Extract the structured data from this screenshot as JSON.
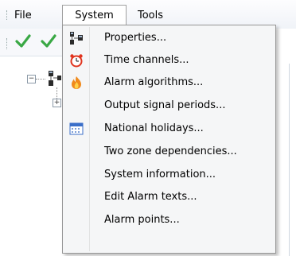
{
  "menubar": {
    "items": [
      {
        "label": "File"
      },
      {
        "label": "System"
      },
      {
        "label": "Tools"
      }
    ]
  },
  "toolbar": {
    "icons": [
      "green-checkmark-icon",
      "green-checkmark-icon"
    ]
  },
  "system_menu": {
    "items": [
      {
        "label": "Properties...",
        "icon": "network-icon"
      },
      {
        "label": "Time channels...",
        "icon": "alarm-clock-icon"
      },
      {
        "label": "Alarm algorithms...",
        "icon": "flame-icon"
      },
      {
        "label": "Output signal periods...",
        "icon": ""
      },
      {
        "label": "National holidays...",
        "icon": "calendar-icon"
      },
      {
        "label": "Two zone dependencies...",
        "icon": ""
      },
      {
        "label": "System information...",
        "icon": ""
      },
      {
        "label": "Edit Alarm texts...",
        "icon": ""
      },
      {
        "label": "Alarm points...",
        "icon": ""
      }
    ]
  },
  "colors": {
    "check_green": "#3aa845",
    "menu_bg": "#f5f6f7",
    "menu_border": "#979797",
    "clock_red": "#e0341e",
    "flame_orange": "#f08a1c",
    "calendar_blue": "#3b6fc9"
  }
}
